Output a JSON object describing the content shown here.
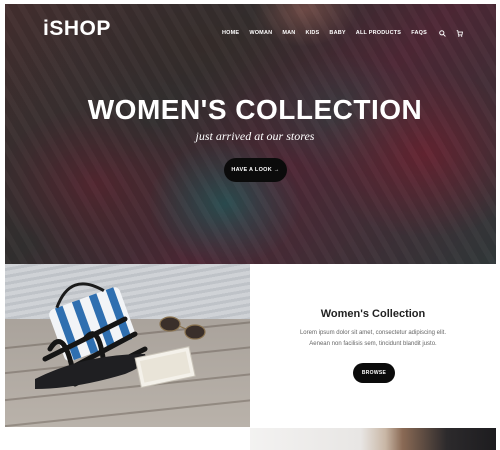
{
  "header": {
    "logo": "iSHOP",
    "nav": [
      "HOME",
      "WOMAN",
      "MAN",
      "KIDS",
      "BABY",
      "ALL PRODUCTS",
      "FAQS"
    ],
    "icons": [
      "search-icon",
      "cart-icon"
    ]
  },
  "hero": {
    "title": "WOMEN'S COLLECTION",
    "subtitle": "just arrived at our stores",
    "button": "HAVE A LOOK →"
  },
  "promo": {
    "title": "Women's Collection",
    "text_line1": "Lorem ipsum dolor sit amet, consectetur adipiscing elit.",
    "text_line2": "Aenean non facilisis sem, tincidunt blandit justo.",
    "button": "BROWSE"
  },
  "colors": {
    "button_bg": "#0b0b0b",
    "text_light": "#ffffff",
    "promo_title": "#222222",
    "promo_text": "#666666"
  }
}
